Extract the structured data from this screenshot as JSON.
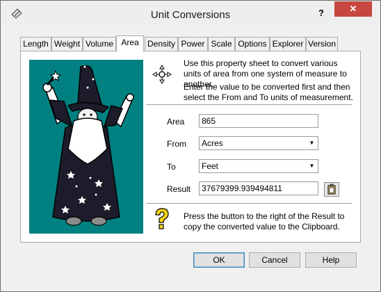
{
  "window": {
    "title": "Unit Conversions",
    "help_glyph": "?",
    "close_glyph": "✕"
  },
  "tabs": [
    {
      "label": "Length"
    },
    {
      "label": "Weight"
    },
    {
      "label": "Volume"
    },
    {
      "label": "Area"
    },
    {
      "label": "Density"
    },
    {
      "label": "Power"
    },
    {
      "label": "Scale"
    },
    {
      "label": "Options"
    },
    {
      "label": "Explorer"
    },
    {
      "label": "Version"
    }
  ],
  "active_tab": "Area",
  "panel": {
    "intro": "Use this property sheet to convert various units of area from one system of measure to another.",
    "instructions": "Enter the value to be converted first and then select the From and To units of measurement.",
    "area_label": "Area",
    "area_value": "865",
    "from_label": "From",
    "from_value": "Acres",
    "to_label": "To",
    "to_value": "Feet",
    "result_label": "Result",
    "result_value": "37679399.939494811",
    "hint": "Press the button to the right of the Result to copy the converted value to the Clipboard.",
    "dropdown_glyph": "▼"
  },
  "buttons": {
    "ok": "OK",
    "cancel": "Cancel",
    "help": "Help"
  },
  "colors": {
    "wizard_bg": "#008080",
    "close_bg": "#c7463f"
  }
}
